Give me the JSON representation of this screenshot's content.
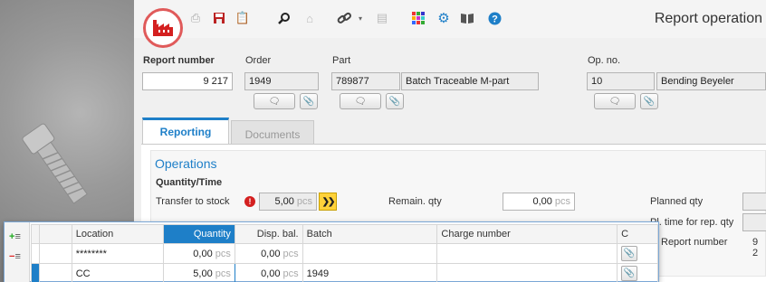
{
  "window": {
    "title": "Report operation"
  },
  "colors": {
    "accent": "#1e7fc8",
    "brand_red": "#e03a3a",
    "error": "#d42020",
    "highlight": "#ffd23a"
  },
  "toolbar": {
    "icons": [
      "print-icon",
      "save-icon",
      "clipboard-icon",
      "search-icon",
      "home-icon",
      "link-icon",
      "form-icon",
      "apps-grid-icon",
      "gear-icon",
      "book-icon",
      "help-icon"
    ]
  },
  "header": {
    "report_number": {
      "label": "Report number",
      "value": "9 217"
    },
    "order": {
      "label": "Order",
      "value": "1949"
    },
    "part": {
      "label": "Part",
      "number": "789877",
      "name": "Batch Traceable M-part"
    },
    "op_no": {
      "label": "Op. no.",
      "number": "10",
      "name": "Bending Beyeler"
    }
  },
  "tabs": [
    {
      "label": "Reporting",
      "active": true
    },
    {
      "label": "Documents",
      "active": false
    }
  ],
  "operations": {
    "title": "Operations",
    "quantity_time_title": "Quantity/Time",
    "transfer_to_stock": {
      "label": "Transfer to stock",
      "value": "5,00",
      "unit": "pcs"
    },
    "remain_qty": {
      "label": "Remain. qty",
      "value": "0,00",
      "unit": "pcs"
    },
    "planned_qty": {
      "label": "Planned qty"
    },
    "pl_time": {
      "label": "Pl. time for rep. qty"
    },
    "report_number_right": {
      "label": "Report number",
      "value": "9 2"
    }
  },
  "grid": {
    "columns": [
      "Location",
      "Quantity",
      "Disp. bal.",
      "Batch",
      "Charge number",
      "C"
    ],
    "rows": [
      {
        "location": "********",
        "quantity": "0,00",
        "disp_bal": "0,00",
        "batch": "",
        "charge_number": "",
        "unit": "pcs"
      },
      {
        "location": "CC",
        "quantity": "5,00",
        "disp_bal": "0,00",
        "batch": "1949",
        "charge_number": "",
        "unit": "pcs"
      }
    ]
  }
}
